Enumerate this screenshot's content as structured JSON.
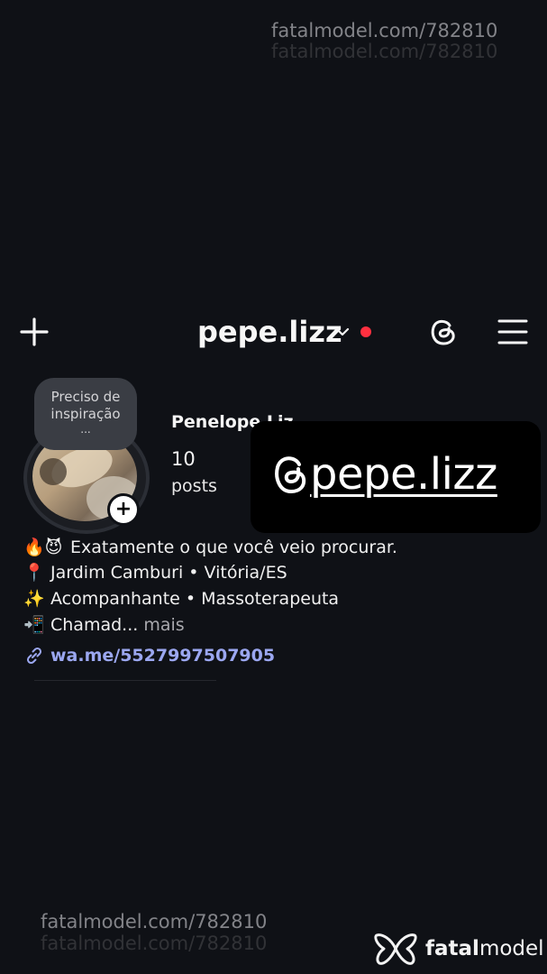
{
  "watermarks": {
    "top": "fatalmodel.com/782810",
    "bottom": "fatalmodel.com/782810"
  },
  "header": {
    "username": "pepe.lizz",
    "icons": [
      "plus-icon",
      "chevron-down-icon",
      "notification-dot",
      "threads-icon",
      "menu-icon"
    ],
    "notification_color": "#ff3040"
  },
  "profile": {
    "note": "Preciso de inspiração",
    "note_ellipsis": "...",
    "display_name": "Penelope Liz",
    "posts_count": "10",
    "posts_label": "posts"
  },
  "overlay": {
    "handle": "pepe.lizz",
    "icon": "threads-icon"
  },
  "bio": {
    "line1_emoji": "🔥😈",
    "line1": "Exatamente o que você veio procurar.",
    "line2_emoji": "📍",
    "line2": "Jardim Camburi • Vitória/ES",
    "line3_emoji": "✨",
    "line3": "Acompanhante • Massoterapeuta",
    "line4_emoji": "📲",
    "line4": "Chamad...",
    "more": "mais",
    "link": "wa.me/5527997507905",
    "link_color": "#9ba7f0"
  },
  "brand": {
    "name_bold": "fatal",
    "name_rest": "model"
  }
}
